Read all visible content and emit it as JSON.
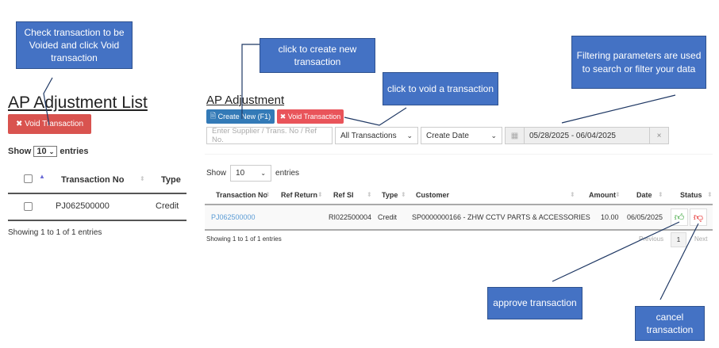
{
  "left": {
    "title": "AP Adjustment List",
    "void_button": "Void Transaction",
    "show_label": "Show",
    "entries_label": "entries",
    "page_size": "10",
    "columns": [
      "Transaction No",
      "Type"
    ],
    "rows": [
      {
        "transaction_no": "PJ062500000",
        "type": "Credit"
      }
    ],
    "footer": "Showing 1 to 1 of 1 entries"
  },
  "right": {
    "title": "AP Adjustment",
    "create_button": "Create New (F1)",
    "void_button": "Void Transaction",
    "search_placeholder": "Enter Supplier / Trans. No / Ref No.",
    "type_filter": "All Transactions",
    "date_filter": "Create Date",
    "date_range": "05/28/2025 - 06/04/2025",
    "clear_icon": "×",
    "show_label": "Show",
    "entries_label": "entries",
    "page_size": "10",
    "columns": [
      "Transaction No",
      "Ref Return",
      "Ref SI",
      "Type",
      "Customer",
      "Amount",
      "Date",
      "Status"
    ],
    "rows": [
      {
        "transaction_no": "PJ062500000",
        "ref_return": "",
        "ref_si": "RI022500004",
        "type": "Credit",
        "customer": "SP0000000166 - ZHW CCTV PARTS & ACCESSORIES",
        "amount": "10.00",
        "date": "06/05/2025"
      }
    ],
    "footer": "Showing 1 to 1 of 1 entries",
    "pagination": {
      "previous": "Previous",
      "page": "1",
      "next": "Next"
    }
  },
  "callouts": {
    "void_check": "Check transaction to be Voided and click Void transaction",
    "create": "click to create new transaction",
    "void": "click to void a transaction",
    "filter": "Filtering parameters are used to search or filter your data",
    "approve": "approve transaction",
    "cancel": "cancel transaction"
  },
  "colors": {
    "callout": "#4472C4",
    "danger": "#d9534f",
    "primary": "#337ab7",
    "approve": "#2e9e2e",
    "cancel": "#e00000"
  }
}
